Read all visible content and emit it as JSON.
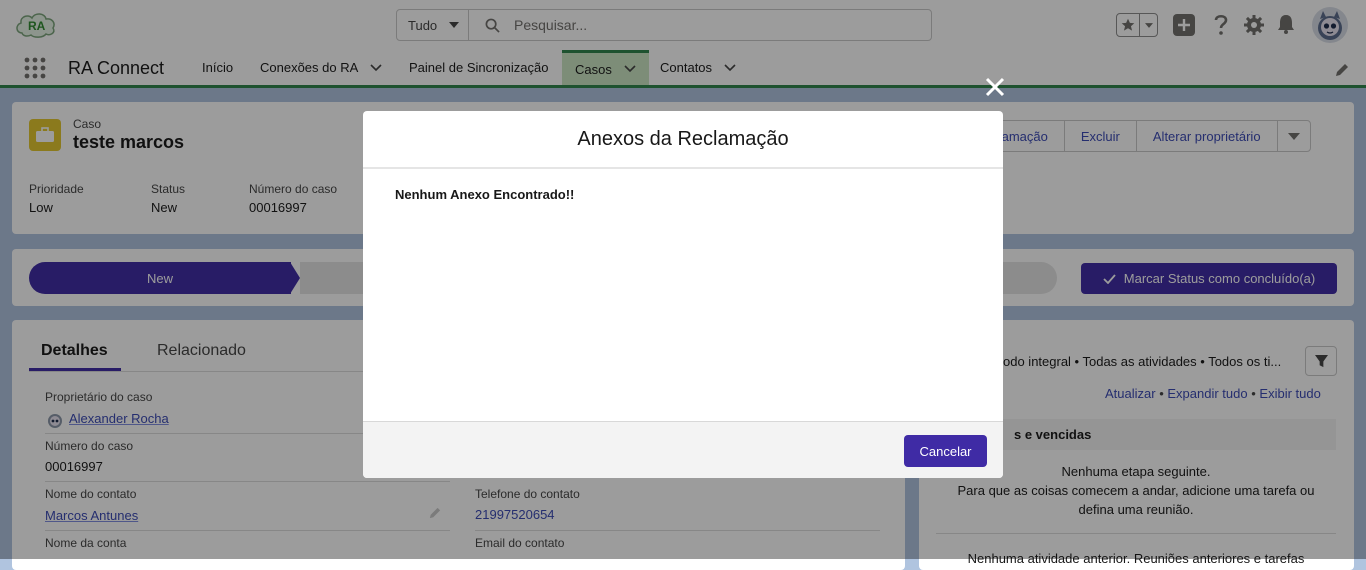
{
  "header": {
    "search": {
      "scope": "Tudo",
      "placeholder": "Pesquisar..."
    },
    "logo_text": "RA"
  },
  "nav": {
    "app_name": "RA Connect",
    "tabs": [
      {
        "label": "Início",
        "has_menu": false
      },
      {
        "label": "Conexões do RA",
        "has_menu": true
      },
      {
        "label": "Painel de Sincronização",
        "has_menu": false
      },
      {
        "label": "Casos",
        "has_menu": true,
        "active": true
      },
      {
        "label": "Contatos",
        "has_menu": true
      }
    ]
  },
  "record": {
    "object_type": "Caso",
    "title": "teste marcos",
    "actions": [
      "eclamação",
      "Excluir",
      "Alterar proprietário"
    ],
    "highlights": [
      {
        "label": "Prioridade",
        "value": "Low"
      },
      {
        "label": "Status",
        "value": "New"
      },
      {
        "label": "Número do caso",
        "value": "00016997"
      }
    ]
  },
  "path": {
    "current_stage": "New",
    "mark_button": "Marcar Status como concluído(a)"
  },
  "details": {
    "tabs": [
      "Detalhes",
      "Relacionado"
    ],
    "fields": [
      {
        "label": "Proprietário do caso",
        "value": "Alexander Rocha"
      },
      {
        "label": "Número do caso",
        "value": "00016997"
      },
      {
        "label": "Nome do contato",
        "value": "Marcos Antunes"
      },
      {
        "label": "Nome da conta",
        "value": ""
      }
    ],
    "right_fields": [
      {
        "label": "Telefone do contato",
        "value": "21997520654"
      },
      {
        "label": "Email do contato",
        "value": ""
      }
    ]
  },
  "activity": {
    "filter_text": "odo integral • Todas as atividades • Todos os ti...",
    "links": [
      "Atualizar",
      "Expandir tudo",
      "Exibir tudo"
    ],
    "section_title": "s e vencidas",
    "empty_line1": "Nenhuma etapa seguinte.",
    "empty_line2": "Para que as coisas comecem a andar, adicione uma tarefa ou",
    "empty_line3": "defina uma reunião.",
    "past_text": "Nenhuma atividade anterior. Reuniões anteriores e tarefas"
  },
  "modal": {
    "title": "Anexos da Reclamação",
    "message": "Nenhum Anexo Encontrado!!",
    "cancel_label": "Cancelar"
  }
}
